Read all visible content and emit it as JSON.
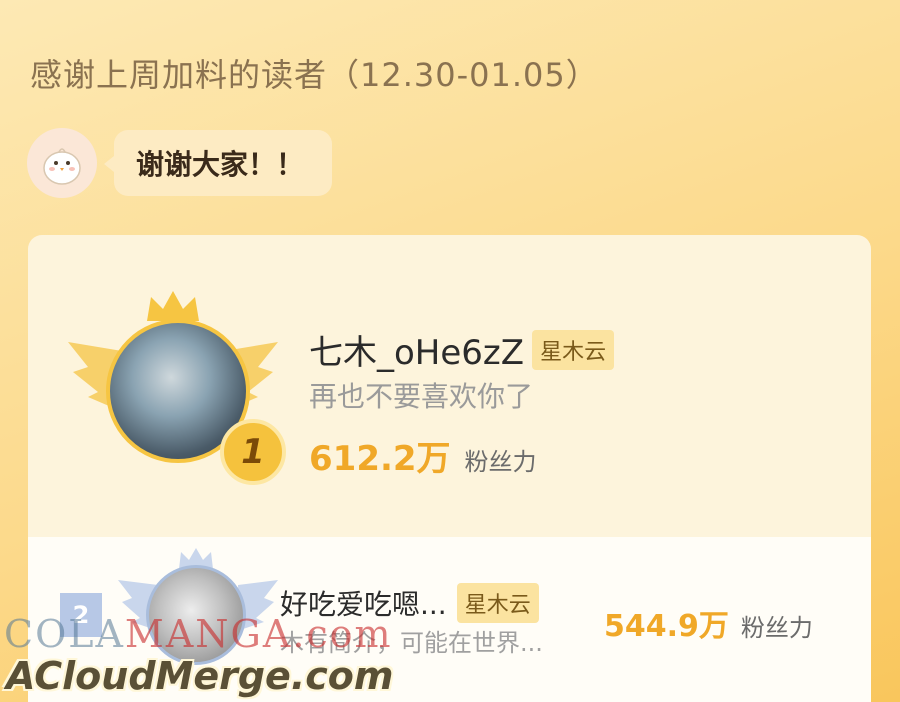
{
  "header": {
    "title": "感谢上周加料的读者（12.30-01.05）"
  },
  "greeting": {
    "text": "谢谢大家！！"
  },
  "rank1": {
    "rank": "1",
    "name": "七木_oHe6zZ",
    "tag": "星木云",
    "signature": "再也不要喜欢你了",
    "fans_value": "612.2万",
    "fans_label": "粉丝力"
  },
  "rank2": {
    "rank": "2",
    "name": "好吃爱吃嗯...",
    "tag": "星木云",
    "signature": "木有简介，可能在世界...",
    "fans_value": "544.9万",
    "fans_label": "粉丝力"
  },
  "watermark": {
    "line1_a": "COLA",
    "line1_b": "MANGA",
    "line1_c": ".com",
    "line2": "ACloudMerge.com"
  },
  "colors": {
    "accent": "#f0a828",
    "gold_badge": "#f5c23d",
    "silver_badge": "#b7c8e6",
    "background": "#fcd98a"
  }
}
